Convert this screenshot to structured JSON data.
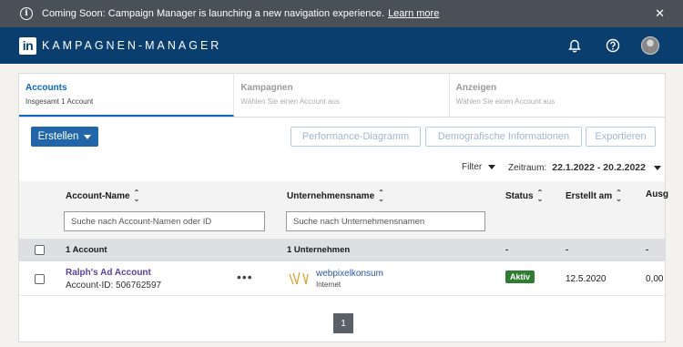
{
  "banner": {
    "text": "Coming Soon: Campaign Manager is launching a new navigation experience.",
    "link": "Learn more"
  },
  "header": {
    "logo": "in",
    "brand": "KAMPAGNEN-MANAGER"
  },
  "tabs": [
    {
      "title": "Accounts",
      "subtitle": "Insgesamt 1 Account"
    },
    {
      "title": "Kampagnen",
      "subtitle": "Wählen Sie einen Account aus"
    },
    {
      "title": "Anzeigen",
      "subtitle": "Wählen Sie einen Account aus"
    }
  ],
  "toolbar": {
    "create": "Erstellen",
    "performance": "Performance-Diagramm",
    "demographics": "Demografische Informationen",
    "export": "Exportieren"
  },
  "filterbar": {
    "filter": "Filter",
    "period_label": "Zeitraum:",
    "period_value": "22.1.2022 - 20.2.2022"
  },
  "table": {
    "columns": {
      "account": "Account-Name",
      "company": "Unternehmensname",
      "status": "Status",
      "created": "Erstellt am",
      "spend": "Ausg"
    },
    "search_account_placeholder": "Suche nach Account-Namen oder ID",
    "search_company_placeholder": "Suche nach Unternehmensnamen",
    "summary": {
      "account": "1 Account",
      "company": "1 Unternehmen",
      "status": "-",
      "created": "-",
      "spend": "-"
    },
    "rows": [
      {
        "name": "Ralph's Ad Account",
        "id": "Account-ID: 506762597",
        "company": "webpixelkonsum",
        "company_sub": "Internet",
        "status": "Aktiv",
        "created": "12.5.2020",
        "spend": "0,00 "
      }
    ]
  },
  "pagination": {
    "current": "1"
  },
  "colors": {
    "header_bg": "#0a3e6e",
    "banner_bg": "#4a5058",
    "accent": "#0a66c2",
    "status_active": "#2e7d32"
  }
}
